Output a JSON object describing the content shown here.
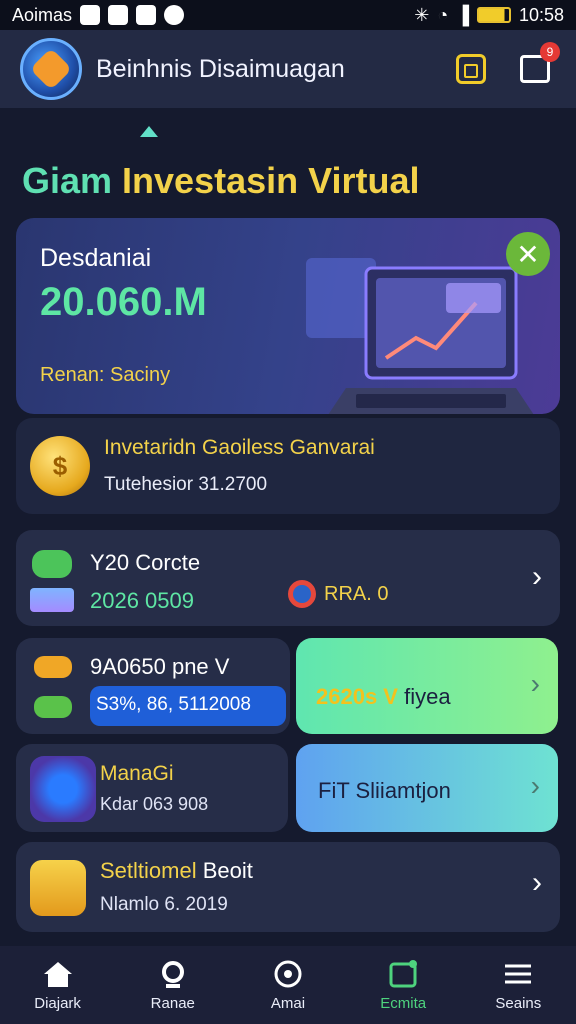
{
  "status_bar": {
    "carrier": "Aoimas",
    "time": "10:58"
  },
  "header": {
    "title": "Beinhnis Disaimuagan",
    "notification_count": "9"
  },
  "page_title": {
    "part1": "Giam ",
    "part2": "Investasin Virtual"
  },
  "hero": {
    "label": "Desdaniai",
    "value": "20.060.M",
    "sub": "Renan: Saciny"
  },
  "info_card": {
    "title": "Invetaridn Gaoiless Ganvarai",
    "subtitle": "Tutehesior 31.2700",
    "coin_symbol": "$"
  },
  "row1": {
    "title": "Y20 Corcte",
    "value": "2026 0509",
    "pill": "RRA. 0"
  },
  "left_card": {
    "title": "9A0650 pne V",
    "bar_text": "S3%, 86, 5112008"
  },
  "right_card1": {
    "highlight": "2620s V",
    "rest": " fiyea"
  },
  "right_card2": {
    "text": "FiT Sliiamtjon"
  },
  "left_card2": {
    "title": "ManaGi",
    "subtitle": "Kdar 063 908"
  },
  "row4": {
    "title_yellow": "Setltiomel ",
    "title_white": "Beoit",
    "subtitle": "Nlamlo 6. 2019"
  },
  "nav": [
    {
      "label": "Diajark",
      "icon": "home-icon"
    },
    {
      "label": "Ranae",
      "icon": "search-icon"
    },
    {
      "label": "Amai",
      "icon": "compass-icon"
    },
    {
      "label": "Ecmita",
      "icon": "calendar-icon"
    },
    {
      "label": "Seains",
      "icon": "menu-icon"
    }
  ],
  "colors": {
    "accent_green": "#5ee6a4",
    "accent_yellow": "#f3d24a",
    "background": "#151a2e"
  }
}
